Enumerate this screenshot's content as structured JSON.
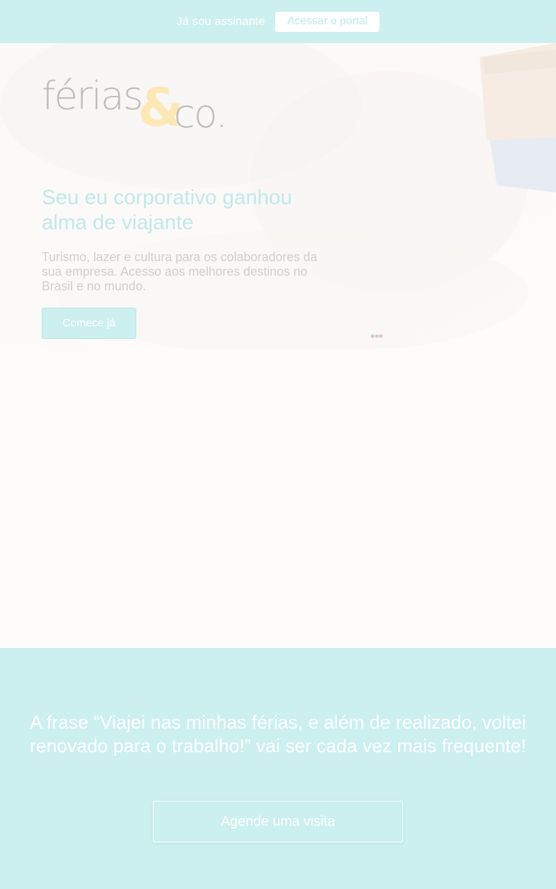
{
  "topbar": {
    "subscriber_label": "Já sou assinante",
    "portal_button": "Acessar o portal"
  },
  "logo": {
    "word": "férias",
    "amp": "&",
    "co": "co.",
    "accent_color": "#fde8b5"
  },
  "hero": {
    "title": "Seu eu corporativo ganhou alma de viajante",
    "description": "Turismo, lazer e cultura para os colaboradores da sua empresa. Acesso aos melhores destinos no Brasil e no mundo.",
    "start_button": "Comece já"
  },
  "cta": {
    "text": "A frase “Viajei nas minhas férias, e além de realizado, voltei renovado para o trabalho!” vai ser cada vez mais frequente!",
    "visit_button": "Agende uma visita"
  },
  "colors": {
    "accent_teal": "#ccefef",
    "title_teal": "#bfe9e9",
    "logo_gray": "#bdbdbd",
    "background": "#fdfcfb"
  }
}
